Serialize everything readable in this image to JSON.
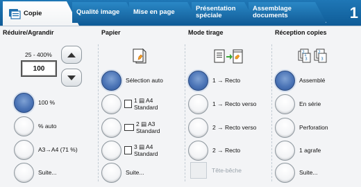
{
  "tabs": [
    {
      "label": "Copie"
    },
    {
      "label": "Qualité image"
    },
    {
      "label": "Mise en page"
    },
    {
      "label_line1": "Présentation",
      "label_line2": "spéciale"
    },
    {
      "label_line1": "Assemblage",
      "label_line2": "documents"
    }
  ],
  "tab_number": "1",
  "reduce": {
    "header": "Réduire/Agrandir",
    "range": "25 - 400%",
    "value": "100",
    "options": [
      "100 %",
      "% auto",
      "A3→A4 (71 %)",
      "Suite..."
    ]
  },
  "paper": {
    "header": "Papier",
    "options": [
      {
        "line1": "Sélection auto"
      },
      {
        "line1": "1 ▤ A4",
        "line2": "Standard"
      },
      {
        "line1": "2 ▤ A3",
        "line2": "Standard"
      },
      {
        "line1": "3 ▤ A4",
        "line2": "Standard"
      },
      {
        "line1": "Suite..."
      }
    ]
  },
  "sides": {
    "header": "Mode tirage",
    "options": [
      "1 → Recto",
      "1 → Recto verso",
      "2 → Recto verso",
      "2 → Recto"
    ],
    "checkbox": "Tête-bêche"
  },
  "output": {
    "header": "Réception copies",
    "options": [
      "Assemblé",
      "En série",
      "Perforation",
      "1 agrafe",
      "Suite..."
    ]
  },
  "colors": {
    "accent": "#1a6fae",
    "selected_radio": "#4b74b6"
  }
}
